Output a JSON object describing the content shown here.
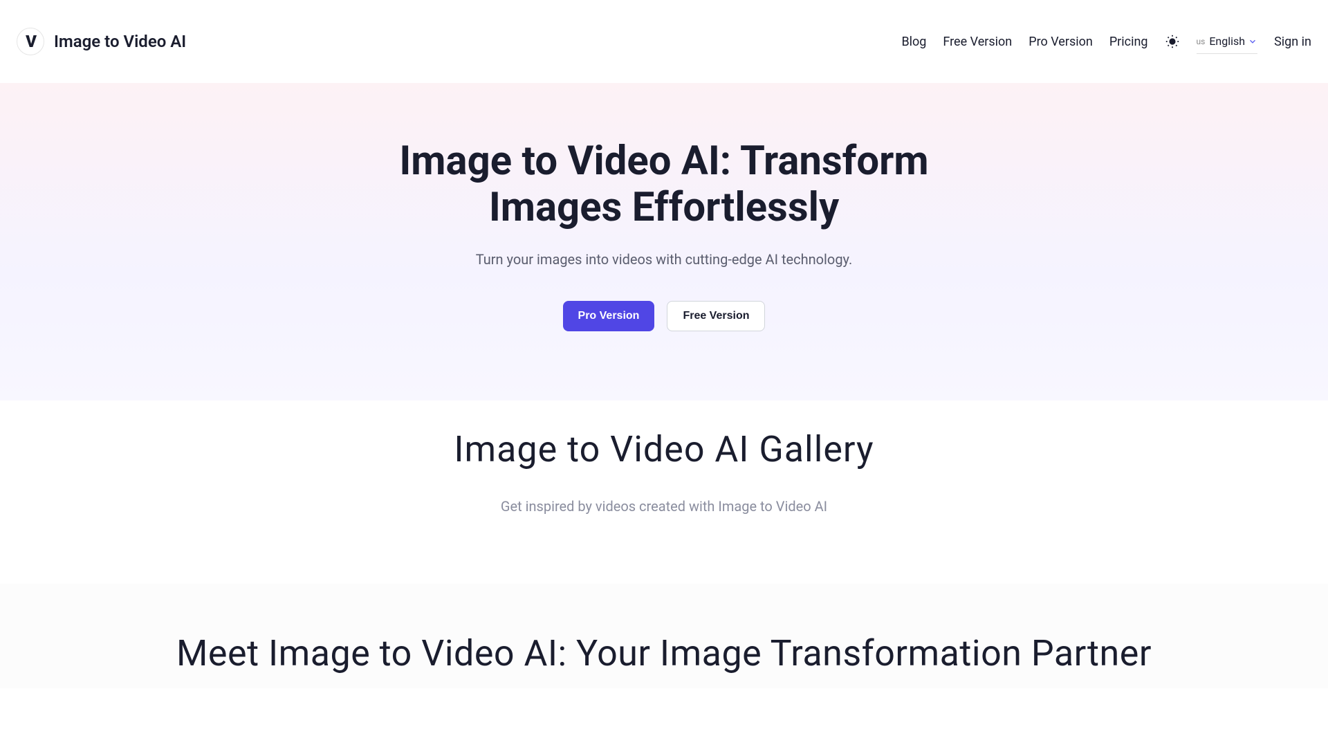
{
  "header": {
    "logo_text": "Image to Video AI",
    "nav": {
      "blog": "Blog",
      "free_version": "Free Version",
      "pro_version": "Pro Version",
      "pricing": "Pricing",
      "language_prefix": "us",
      "language": "English",
      "sign_in": "Sign in"
    }
  },
  "hero": {
    "title": "Image to Video AI: Transform Images Effortlessly",
    "subtitle": "Turn your images into videos with cutting-edge AI technology.",
    "cta_primary": "Pro Version",
    "cta_secondary": "Free Version"
  },
  "gallery": {
    "title": "Image to Video AI Gallery",
    "subtitle": "Get inspired by videos created with Image to Video AI"
  },
  "partner": {
    "title": "Meet Image to Video AI: Your Image Transformation Partner"
  }
}
